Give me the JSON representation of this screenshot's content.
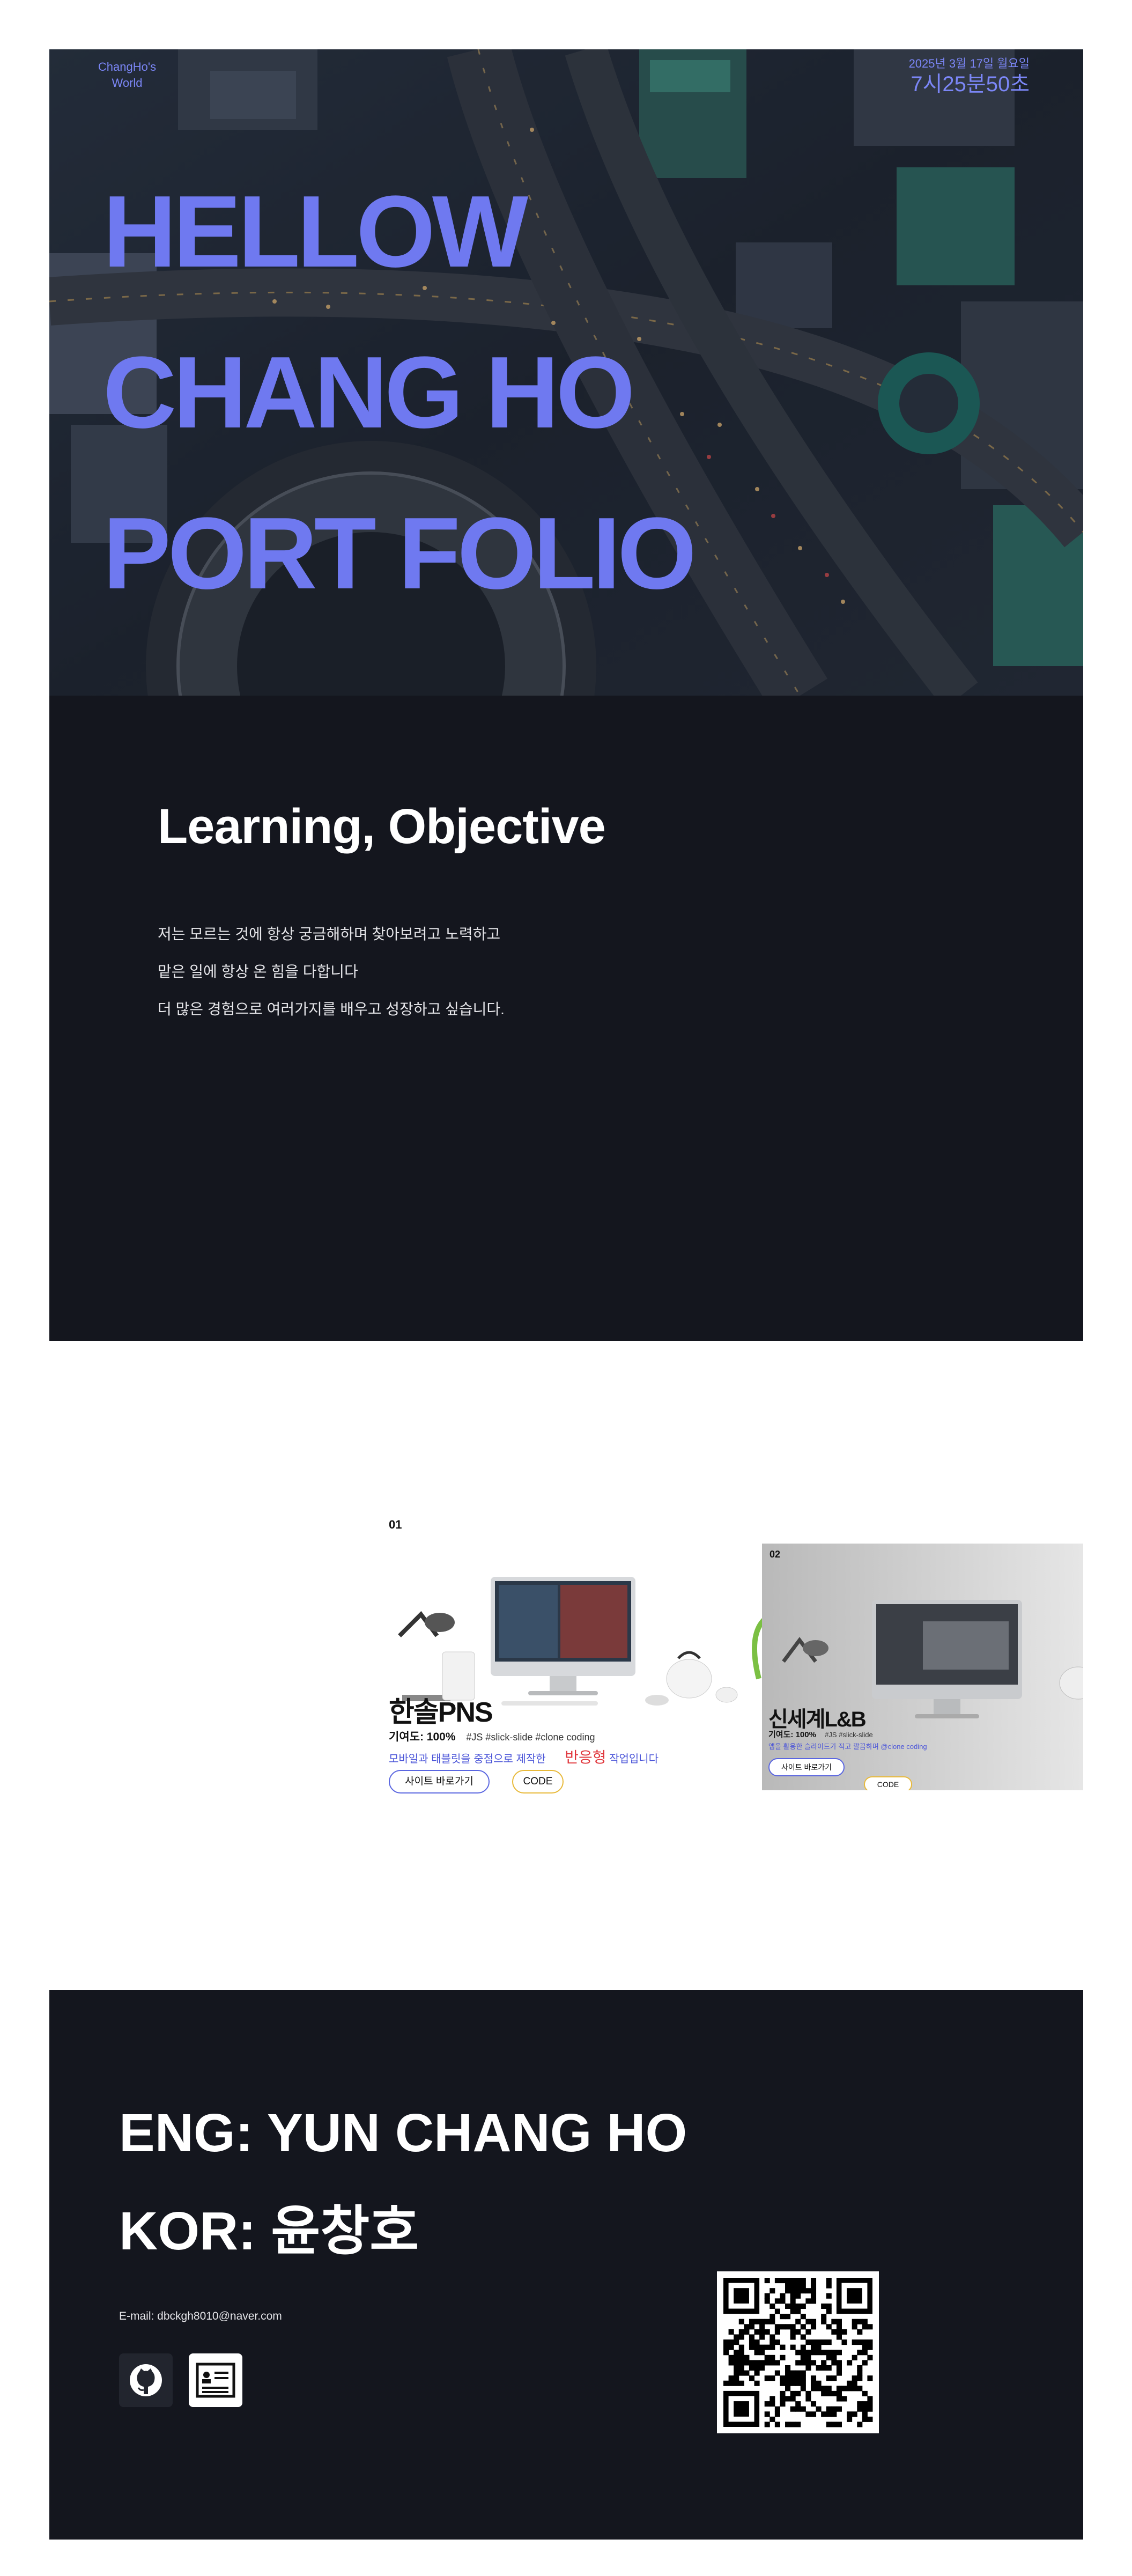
{
  "hero": {
    "brand_line1": "ChangHo's",
    "brand_line2": "World",
    "date": "2025년 3월 17일 월요일",
    "time": "7시25분50초",
    "title_lines": [
      "HELLOW",
      "CHANG HO",
      "PORT FOLIO"
    ]
  },
  "learning": {
    "heading": "Learning, Objective",
    "lines": [
      "저는 모르는 것에 항상 궁금해하며 찾아보려고 노력하고",
      "맡은 일에 항상 온 힘을 다합니다",
      "더 많은 경험으로 여러가지를 배우고 성장하고 싶습니다."
    ]
  },
  "projects": [
    {
      "number": "01",
      "title": "한솔PNS",
      "contribution": "기여도: 100%",
      "tags": "#JS  #slick-slide  #clone coding",
      "desc_before": "모바일과 태블릿을 중점으로 제작한",
      "desc_highlight": "반응형",
      "desc_after": "작업입니다",
      "site_button": "사이트 바로가기",
      "code_button": "CODE"
    },
    {
      "number": "02",
      "title": "신세계L&B",
      "contribution": "기여도: 100%",
      "tags": "#JS  #slick-slide",
      "desc": "앱을 활용한 슬라이드가 적고 깔끔하며 @clone coding",
      "site_button": "사이트 바로가기",
      "code_button": "CODE"
    }
  ],
  "contact": {
    "eng_name": "ENG: YUN CHANG HO",
    "kor_name": "KOR: 윤창호",
    "email": "E-mail: dbckgh8010@naver.com",
    "github_icon": "github-icon",
    "resume_icon": "resume-icon"
  },
  "colors": {
    "accent": "#6f79f0",
    "dark_bg": "#14161e",
    "code_border": "#e8b93a",
    "site_border": "#5a66e0",
    "highlight_red": "#e0353b"
  }
}
